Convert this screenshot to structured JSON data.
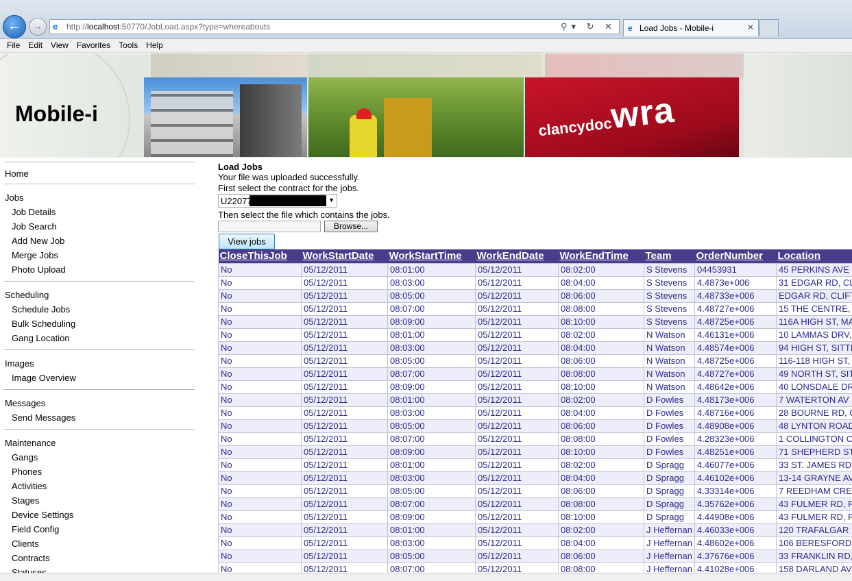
{
  "browser": {
    "url_prefix": "http://",
    "url_host": "localhost",
    "url_rest": ":50770/JobLoad.aspx?type=whereabouts",
    "tab_title": "Load Jobs - Mobile-i",
    "tab_close": "✕",
    "back_glyph": "←",
    "forward_glyph": "→",
    "addr_tools": "⚲▾ ↻ ✕"
  },
  "menu": [
    "File",
    "Edit",
    "View",
    "Favorites",
    "Tools",
    "Help"
  ],
  "banner": {
    "logo": "Mobile-i",
    "brand_small": "clancydoc",
    "brand_big": "wra"
  },
  "sidebar": {
    "home": "Home",
    "jobs": {
      "title": "Jobs",
      "items": [
        "Job Details",
        "Job Search",
        "Add New Job",
        "Merge Jobs",
        "Photo Upload"
      ]
    },
    "scheduling": {
      "title": "Scheduling",
      "items": [
        "Schedule Jobs",
        "Bulk Scheduling",
        "Gang Location"
      ]
    },
    "images": {
      "title": "Images",
      "items": [
        "Image Overview"
      ]
    },
    "messages": {
      "title": "Messages",
      "items": [
        "Send Messages"
      ]
    },
    "maintenance": {
      "title": "Maintenance",
      "items": [
        "Gangs",
        "Phones",
        "Activities",
        "Stages",
        "Device Settings",
        "Field Config",
        "Clients",
        "Contracts",
        "Statuses"
      ]
    }
  },
  "main": {
    "title": "Load Jobs",
    "upload_msg": "Your file was uploaded successfully.",
    "contract_prompt": "First select the contract for the jobs.",
    "contract_value": "U22077",
    "file_prompt": "Then select the file which contains the jobs.",
    "browse_label": "Browse...",
    "view_jobs_label": "View jobs"
  },
  "grid": {
    "columns": [
      "CloseThisJob",
      "WorkStartDate",
      "WorkStartTime",
      "WorkEndDate",
      "WorkEndTime",
      "Team",
      "OrderNumber",
      "Location"
    ],
    "rows": [
      [
        "No",
        "05/12/2011",
        "08:01:00",
        "05/12/2011",
        "08:02:00",
        "S Stevens",
        "04453931",
        "45 PERKINS AVE"
      ],
      [
        "No",
        "05/12/2011",
        "08:03:00",
        "05/12/2011",
        "08:04:00",
        "S Stevens",
        "4.4873e+006",
        "31 EDGAR RD, CL"
      ],
      [
        "No",
        "05/12/2011",
        "08:05:00",
        "05/12/2011",
        "08:06:00",
        "S Stevens",
        "4.48733e+006",
        "EDGAR RD, CLIFT"
      ],
      [
        "No",
        "05/12/2011",
        "08:07:00",
        "05/12/2011",
        "08:08:00",
        "S Stevens",
        "4.48727e+006",
        "15 THE CENTRE,"
      ],
      [
        "No",
        "05/12/2011",
        "08:09:00",
        "05/12/2011",
        "08:10:00",
        "S Stevens",
        "4.48725e+006",
        "116A HIGH ST, MA"
      ],
      [
        "No",
        "05/12/2011",
        "08:01:00",
        "05/12/2011",
        "08:02:00",
        "N Watson",
        "4.46131e+006",
        "10 LAMMAS DRV,"
      ],
      [
        "No",
        "05/12/2011",
        "08:03:00",
        "05/12/2011",
        "08:04:00",
        "N Watson",
        "4.48574e+006",
        "94 HIGH ST, SITTI"
      ],
      [
        "No",
        "05/12/2011",
        "08:05:00",
        "05/12/2011",
        "08:06:00",
        "N Watson",
        "4.48725e+006",
        "116-118 HIGH ST,"
      ],
      [
        "No",
        "05/12/2011",
        "08:07:00",
        "05/12/2011",
        "08:08:00",
        "N Watson",
        "4.48727e+006",
        "49 NORTH ST, SIT"
      ],
      [
        "No",
        "05/12/2011",
        "08:09:00",
        "05/12/2011",
        "08:10:00",
        "N Watson",
        "4.48642e+006",
        "40 LONSDALE DR"
      ],
      [
        "No",
        "05/12/2011",
        "08:01:00",
        "05/12/2011",
        "08:02:00",
        "D Fowles",
        "4.48173e+006",
        "7 WATERTON AV"
      ],
      [
        "No",
        "05/12/2011",
        "08:03:00",
        "05/12/2011",
        "08:04:00",
        "D Fowles",
        "4.48716e+006",
        "28 BOURNE RD, C"
      ],
      [
        "No",
        "05/12/2011",
        "08:05:00",
        "05/12/2011",
        "08:06:00",
        "D Fowles",
        "4.48908e+006",
        "48 LYNTON ROAD"
      ],
      [
        "No",
        "05/12/2011",
        "08:07:00",
        "05/12/2011",
        "08:08:00",
        "D Fowles",
        "4.28323e+006",
        "1 COLLINGTON CL"
      ],
      [
        "No",
        "05/12/2011",
        "08:09:00",
        "05/12/2011",
        "08:10:00",
        "D Fowles",
        "4.48251e+006",
        "71 SHEPHERD ST"
      ],
      [
        "No",
        "05/12/2011",
        "08:01:00",
        "05/12/2011",
        "08:02:00",
        "D Spragg",
        "4.46077e+006",
        "33 ST. JAMES RD"
      ],
      [
        "No",
        "05/12/2011",
        "08:03:00",
        "05/12/2011",
        "08:04:00",
        "D Spragg",
        "4.46102e+006",
        "13-14 GRAYNE AV"
      ],
      [
        "No",
        "05/12/2011",
        "08:05:00",
        "05/12/2011",
        "08:06:00",
        "D Spragg",
        "4.33314e+006",
        "7 REEDHAM CRE"
      ],
      [
        "No",
        "05/12/2011",
        "08:07:00",
        "05/12/2011",
        "08:08:00",
        "D Spragg",
        "4.35762e+006",
        "43 FULMER RD, F"
      ],
      [
        "No",
        "05/12/2011",
        "08:09:00",
        "05/12/2011",
        "08:10:00",
        "D Spragg",
        "4.44908e+006",
        "43 FULMER RD, F"
      ],
      [
        "No",
        "05/12/2011",
        "08:01:00",
        "05/12/2011",
        "08:02:00",
        "J Heffernan",
        "4.46033e+006",
        "120 TRAFALGAR"
      ],
      [
        "No",
        "05/12/2011",
        "08:03:00",
        "05/12/2011",
        "08:04:00",
        "J Heffernan",
        "4.48602e+006",
        "106 BERESFORD"
      ],
      [
        "No",
        "05/12/2011",
        "08:05:00",
        "05/12/2011",
        "08:06:00",
        "J Heffernan",
        "4.37676e+006",
        "33 FRANKLIN RD,"
      ],
      [
        "No",
        "05/12/2011",
        "08:07:00",
        "05/12/2011",
        "08:08:00",
        "J Heffernan",
        "4.41028e+006",
        "158 DARLAND AV"
      ]
    ]
  },
  "colors": {
    "grid_header": "#4b3c8b",
    "grid_text": "#2a2a8c",
    "row_alt": "#eeeefa"
  }
}
